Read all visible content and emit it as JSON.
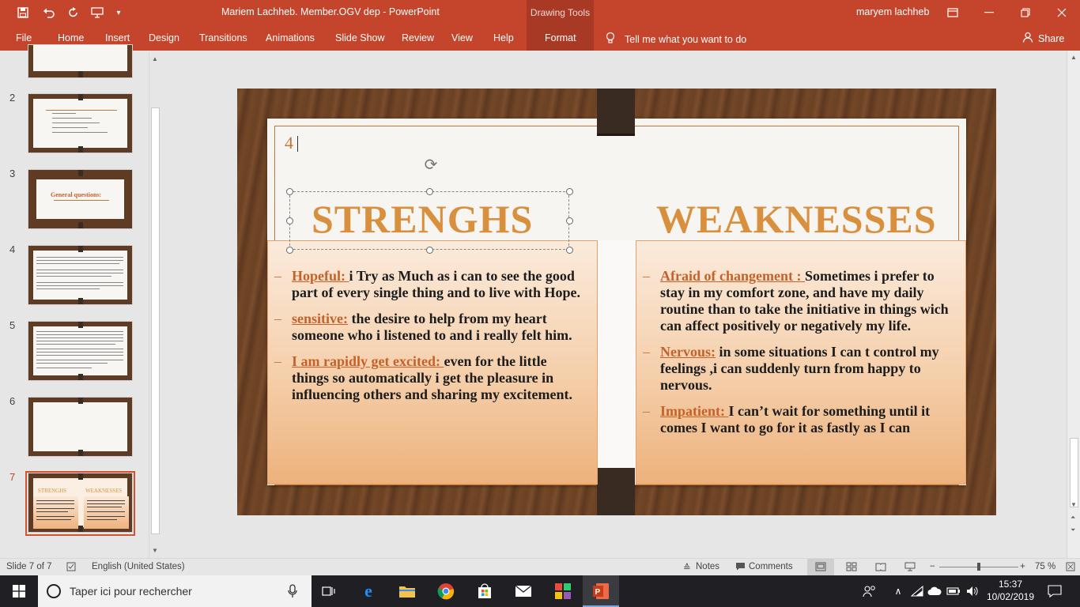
{
  "window": {
    "title": "Mariem Lachheb. Member.OGV dep  -  PowerPoint",
    "context_tab_group": "Drawing Tools",
    "user": "maryem lachheb"
  },
  "ribbon": {
    "tabs": [
      "File",
      "Home",
      "Insert",
      "Design",
      "Transitions",
      "Animations",
      "Slide Show",
      "Review",
      "View",
      "Help",
      "Format"
    ],
    "tell_me": "Tell me what you want to do",
    "share": "Share"
  },
  "thumbnails": {
    "numbers": [
      "2",
      "3",
      "4",
      "5",
      "6",
      "7"
    ],
    "thumb3_title": "General questions:",
    "thumb7_left": "STRENGHS",
    "thumb7_right": "WEAKNESSES",
    "selected": "7"
  },
  "slide": {
    "number": "4",
    "left_heading": "STRENGHS",
    "right_heading": "WEAKNESSES",
    "left_items": [
      {
        "kw": "Hopeful: ",
        "text": " i Try as Much as i can to see the good part of every single thing and to live with Hope."
      },
      {
        "kw": "sensitive:",
        "text": " the desire to help from my heart someone who i listened to and i really felt him."
      },
      {
        "kw": "I am rapidly get excited:  ",
        "text": " even for the little things so automatically i get the pleasure in influencing others and sharing my excitement."
      }
    ],
    "right_items": [
      {
        "kw": "Afraid of changement : ",
        "text": "Sometimes i prefer to stay in my comfort zone, and have my daily routine than to take the initiative in things wich can affect positively or negatively my life."
      },
      {
        "kw": "Nervous:",
        "text": " in some situations I can t control my feelings ,i can suddenly turn from happy to nervous."
      },
      {
        "kw": "Impatient: ",
        "text": "I can’t wait for something until it comes I want to go for it as fastly as I can"
      }
    ]
  },
  "statusbar": {
    "slide_info": "Slide 7 of 7",
    "language": "English (United States)",
    "notes": "Notes",
    "comments": "Comments",
    "zoom": "75 %",
    "zoom_fraction": 0.5
  },
  "taskbar": {
    "search_placeholder": "Taper ici pour rechercher",
    "time": "15:37",
    "date": "10/02/2019"
  },
  "colors": {
    "accent": "#c4452b",
    "heading": "#d9903e",
    "keyword": "#c4622a"
  }
}
